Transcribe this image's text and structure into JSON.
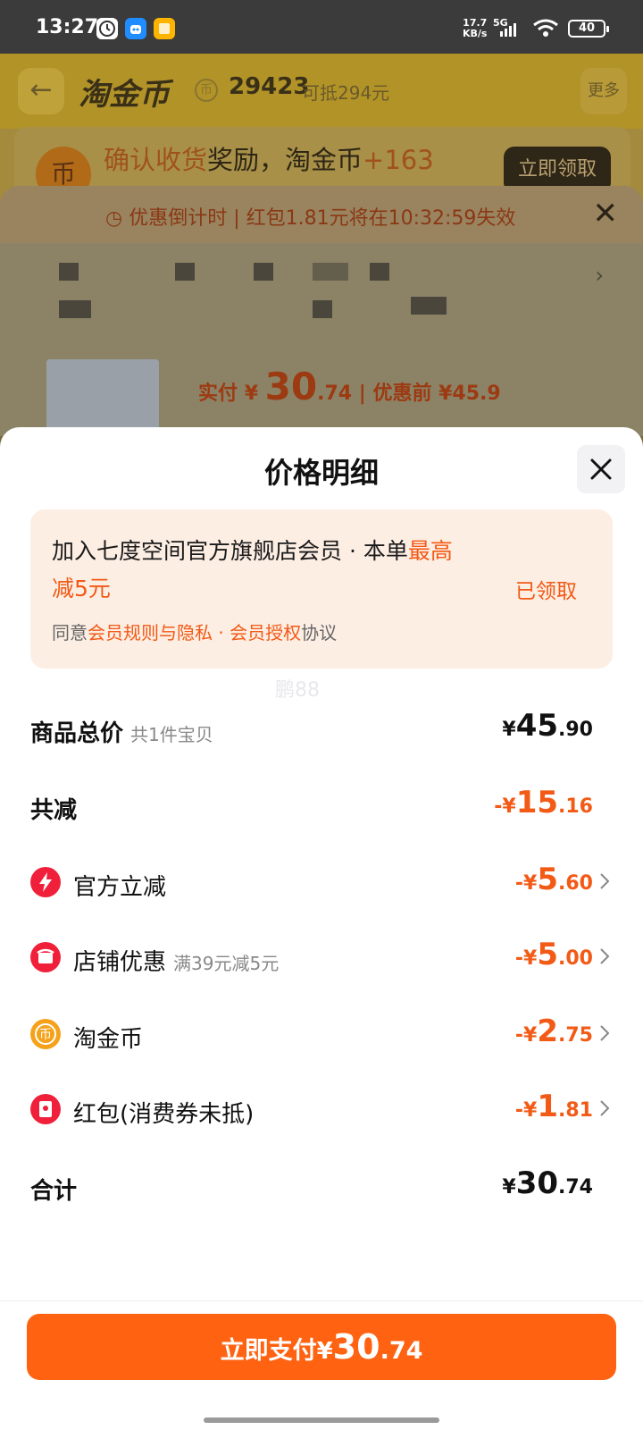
{
  "status_bar": {
    "time": "13:27",
    "net_speed": "17.7",
    "net_unit": "KB/s",
    "network": "5G",
    "battery": "40"
  },
  "background": {
    "title": "淘金币",
    "coin_count": "29423",
    "deduct": "可抵294元",
    "more": "更多",
    "reward_prefix": "确认收货",
    "reward_middle": "奖励，淘金币",
    "reward_points": "+163",
    "reward_button": "立即领取",
    "countdown_label": "优惠倒计时",
    "countdown_text": "红包1.81元将在10:32:59失效",
    "paid_label": "实付",
    "paid_symbol": "¥",
    "paid_int": "30",
    "paid_dec": ".74",
    "before_label": "优惠前 ¥45.9"
  },
  "sheet": {
    "title": "价格明细",
    "promo": {
      "text": "加入七度空间官方旗舰店会员 · 本单",
      "highlight": "最高减5元",
      "status": "已领取",
      "agree_prefix": "同意",
      "agree_link": "会员规则与隐私 · 会员授权",
      "agree_suffix": "协议"
    },
    "watermark": "鹏88",
    "rows": [
      {
        "label": "商品总价",
        "note": "共1件宝贝",
        "symbol": "¥",
        "int": "45",
        "dec": ".90"
      },
      {
        "label": "共减",
        "symbol": "-¥",
        "int": "15",
        "dec": ".16"
      },
      {
        "label": "官方立减",
        "icon": "lightning-icon",
        "symbol": "-¥",
        "int": "5",
        "dec": ".60"
      },
      {
        "label": "店铺优惠",
        "note": "满39元减5元",
        "icon": "shop-icon",
        "symbol": "-¥",
        "int": "5",
        "dec": ".00"
      },
      {
        "label": "淘金币",
        "icon": "coin-icon",
        "symbol": "-¥",
        "int": "2",
        "dec": ".75"
      },
      {
        "label": "红包(消费券未抵)",
        "icon": "red-packet-icon",
        "symbol": "-¥",
        "int": "1",
        "dec": ".81"
      },
      {
        "label": "合计",
        "symbol": "¥",
        "int": "30",
        "dec": ".74"
      }
    ],
    "pay_button": {
      "label": "立即支付",
      "symbol": "¥",
      "int": "30",
      "dec": ".74"
    }
  },
  "colors": {
    "accent": "#ff6211",
    "discount": "#f25a16",
    "promo_bg": "#fdeee4"
  }
}
